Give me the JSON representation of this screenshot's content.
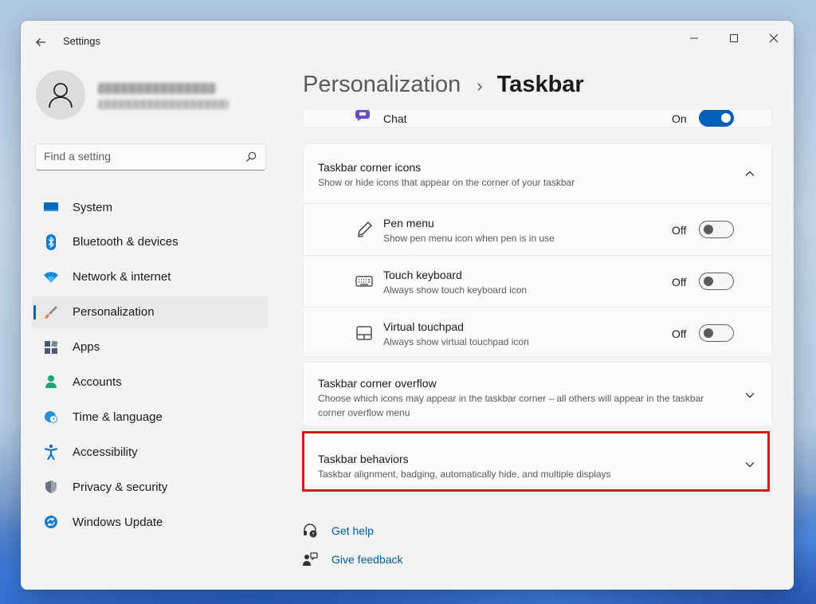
{
  "window": {
    "app_title": "Settings",
    "controls": {
      "minimize": "minimize",
      "maximize": "maximize",
      "close": "close"
    }
  },
  "search": {
    "placeholder": "Find a setting"
  },
  "sidebar": {
    "items": [
      {
        "label": "System",
        "icon": "system-icon",
        "color": "#0067c0",
        "active": false
      },
      {
        "label": "Bluetooth & devices",
        "icon": "bluetooth-icon",
        "color": "#0078d4",
        "active": false
      },
      {
        "label": "Network & internet",
        "icon": "wifi-icon",
        "color": "#0a8ad8",
        "active": false
      },
      {
        "label": "Personalization",
        "icon": "brush-icon",
        "color": "#d58a3a",
        "active": true
      },
      {
        "label": "Apps",
        "icon": "apps-icon",
        "color": "#4a5a73",
        "active": false
      },
      {
        "label": "Accounts",
        "icon": "accounts-icon",
        "color": "#1ea37a",
        "active": false
      },
      {
        "label": "Time & language",
        "icon": "globe-clock-icon",
        "color": "#2a8fcf",
        "active": false
      },
      {
        "label": "Accessibility",
        "icon": "accessibility-icon",
        "color": "#1a6fc0",
        "active": false
      },
      {
        "label": "Privacy & security",
        "icon": "shield-icon",
        "color": "#6b7280",
        "active": false
      },
      {
        "label": "Windows Update",
        "icon": "update-icon",
        "color": "#0a7fd4",
        "active": false
      }
    ]
  },
  "breadcrumb": {
    "parent": "Personalization",
    "separator": "›",
    "current": "Taskbar"
  },
  "chat_row": {
    "label": "Chat",
    "state": "On"
  },
  "corner_icons": {
    "title": "Taskbar corner icons",
    "desc": "Show or hide icons that appear on the corner of your taskbar",
    "rows": [
      {
        "title": "Pen menu",
        "desc": "Show pen menu icon when pen is in use",
        "state": "Off",
        "icon": "pen-icon"
      },
      {
        "title": "Touch keyboard",
        "desc": "Always show touch keyboard icon",
        "state": "Off",
        "icon": "keyboard-icon"
      },
      {
        "title": "Virtual touchpad",
        "desc": "Always show virtual touchpad icon",
        "state": "Off",
        "icon": "touchpad-icon"
      }
    ]
  },
  "corner_overflow": {
    "title": "Taskbar corner overflow",
    "desc": "Choose which icons may appear in the taskbar corner – all others will appear in the taskbar corner overflow menu"
  },
  "behaviors": {
    "title": "Taskbar behaviors",
    "desc": "Taskbar alignment, badging, automatically hide, and multiple displays"
  },
  "help": {
    "get_help": "Get help",
    "give_feedback": "Give feedback"
  },
  "colors": {
    "accent": "#005fb8",
    "highlight": "#d41919",
    "link": "#005a9e"
  }
}
